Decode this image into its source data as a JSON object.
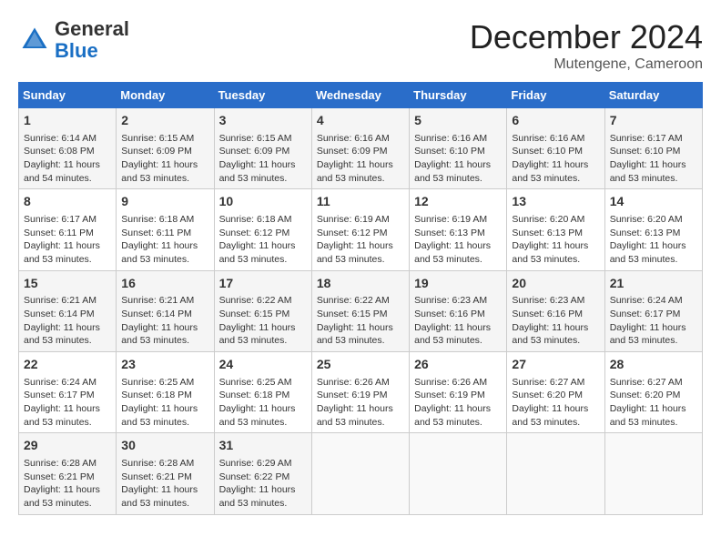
{
  "header": {
    "logo_general": "General",
    "logo_blue": "Blue",
    "month_title": "December 2024",
    "location": "Mutengene, Cameroon"
  },
  "days_of_week": [
    "Sunday",
    "Monday",
    "Tuesday",
    "Wednesday",
    "Thursday",
    "Friday",
    "Saturday"
  ],
  "weeks": [
    [
      {
        "day": "1",
        "sunrise": "6:14 AM",
        "sunset": "6:08 PM",
        "daylight": "11 hours and 54 minutes."
      },
      {
        "day": "2",
        "sunrise": "6:15 AM",
        "sunset": "6:09 PM",
        "daylight": "11 hours and 53 minutes."
      },
      {
        "day": "3",
        "sunrise": "6:15 AM",
        "sunset": "6:09 PM",
        "daylight": "11 hours and 53 minutes."
      },
      {
        "day": "4",
        "sunrise": "6:16 AM",
        "sunset": "6:09 PM",
        "daylight": "11 hours and 53 minutes."
      },
      {
        "day": "5",
        "sunrise": "6:16 AM",
        "sunset": "6:10 PM",
        "daylight": "11 hours and 53 minutes."
      },
      {
        "day": "6",
        "sunrise": "6:16 AM",
        "sunset": "6:10 PM",
        "daylight": "11 hours and 53 minutes."
      },
      {
        "day": "7",
        "sunrise": "6:17 AM",
        "sunset": "6:10 PM",
        "daylight": "11 hours and 53 minutes."
      }
    ],
    [
      {
        "day": "8",
        "sunrise": "6:17 AM",
        "sunset": "6:11 PM",
        "daylight": "11 hours and 53 minutes."
      },
      {
        "day": "9",
        "sunrise": "6:18 AM",
        "sunset": "6:11 PM",
        "daylight": "11 hours and 53 minutes."
      },
      {
        "day": "10",
        "sunrise": "6:18 AM",
        "sunset": "6:12 PM",
        "daylight": "11 hours and 53 minutes."
      },
      {
        "day": "11",
        "sunrise": "6:19 AM",
        "sunset": "6:12 PM",
        "daylight": "11 hours and 53 minutes."
      },
      {
        "day": "12",
        "sunrise": "6:19 AM",
        "sunset": "6:13 PM",
        "daylight": "11 hours and 53 minutes."
      },
      {
        "day": "13",
        "sunrise": "6:20 AM",
        "sunset": "6:13 PM",
        "daylight": "11 hours and 53 minutes."
      },
      {
        "day": "14",
        "sunrise": "6:20 AM",
        "sunset": "6:13 PM",
        "daylight": "11 hours and 53 minutes."
      }
    ],
    [
      {
        "day": "15",
        "sunrise": "6:21 AM",
        "sunset": "6:14 PM",
        "daylight": "11 hours and 53 minutes."
      },
      {
        "day": "16",
        "sunrise": "6:21 AM",
        "sunset": "6:14 PM",
        "daylight": "11 hours and 53 minutes."
      },
      {
        "day": "17",
        "sunrise": "6:22 AM",
        "sunset": "6:15 PM",
        "daylight": "11 hours and 53 minutes."
      },
      {
        "day": "18",
        "sunrise": "6:22 AM",
        "sunset": "6:15 PM",
        "daylight": "11 hours and 53 minutes."
      },
      {
        "day": "19",
        "sunrise": "6:23 AM",
        "sunset": "6:16 PM",
        "daylight": "11 hours and 53 minutes."
      },
      {
        "day": "20",
        "sunrise": "6:23 AM",
        "sunset": "6:16 PM",
        "daylight": "11 hours and 53 minutes."
      },
      {
        "day": "21",
        "sunrise": "6:24 AM",
        "sunset": "6:17 PM",
        "daylight": "11 hours and 53 minutes."
      }
    ],
    [
      {
        "day": "22",
        "sunrise": "6:24 AM",
        "sunset": "6:17 PM",
        "daylight": "11 hours and 53 minutes."
      },
      {
        "day": "23",
        "sunrise": "6:25 AM",
        "sunset": "6:18 PM",
        "daylight": "11 hours and 53 minutes."
      },
      {
        "day": "24",
        "sunrise": "6:25 AM",
        "sunset": "6:18 PM",
        "daylight": "11 hours and 53 minutes."
      },
      {
        "day": "25",
        "sunrise": "6:26 AM",
        "sunset": "6:19 PM",
        "daylight": "11 hours and 53 minutes."
      },
      {
        "day": "26",
        "sunrise": "6:26 AM",
        "sunset": "6:19 PM",
        "daylight": "11 hours and 53 minutes."
      },
      {
        "day": "27",
        "sunrise": "6:27 AM",
        "sunset": "6:20 PM",
        "daylight": "11 hours and 53 minutes."
      },
      {
        "day": "28",
        "sunrise": "6:27 AM",
        "sunset": "6:20 PM",
        "daylight": "11 hours and 53 minutes."
      }
    ],
    [
      {
        "day": "29",
        "sunrise": "6:28 AM",
        "sunset": "6:21 PM",
        "daylight": "11 hours and 53 minutes."
      },
      {
        "day": "30",
        "sunrise": "6:28 AM",
        "sunset": "6:21 PM",
        "daylight": "11 hours and 53 minutes."
      },
      {
        "day": "31",
        "sunrise": "6:29 AM",
        "sunset": "6:22 PM",
        "daylight": "11 hours and 53 minutes."
      },
      null,
      null,
      null,
      null
    ]
  ],
  "labels": {
    "sunrise_prefix": "Sunrise: ",
    "sunset_prefix": "Sunset: ",
    "daylight_label": "Daylight: "
  }
}
